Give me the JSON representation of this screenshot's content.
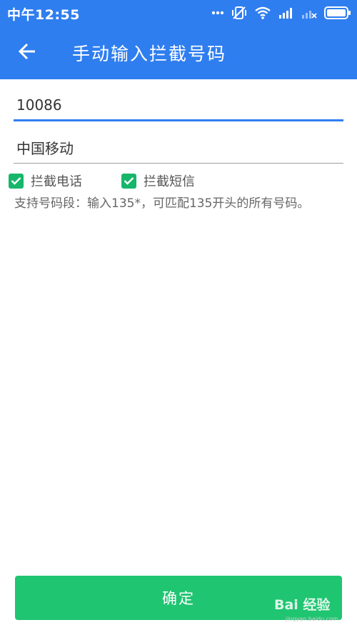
{
  "status_bar": {
    "time": "中午12:55",
    "icons": [
      "more-dots-icon",
      "silent-vibrate-icon",
      "wifi-icon",
      "signal-icon",
      "no-sim-signal-icon",
      "battery-icon"
    ]
  },
  "app_bar": {
    "back_icon": "arrow-left-icon",
    "title": "手动输入拦截号码"
  },
  "form": {
    "number_value": "10086",
    "name_value": "中国移动",
    "block_calls": {
      "label": "拦截电话",
      "checked": true
    },
    "block_sms": {
      "label": "拦截短信",
      "checked": true
    },
    "hint": "支持号码段：输入135*，可匹配135开头的所有号码。"
  },
  "confirm_button": {
    "label": "确定"
  },
  "watermark": {
    "text": "Bai 经验",
    "sub": "jingyan.baidu.com"
  },
  "colors": {
    "primary": "#2f7ef0",
    "accent_green": "#1fc571",
    "checkbox_green": "#17b66b"
  }
}
